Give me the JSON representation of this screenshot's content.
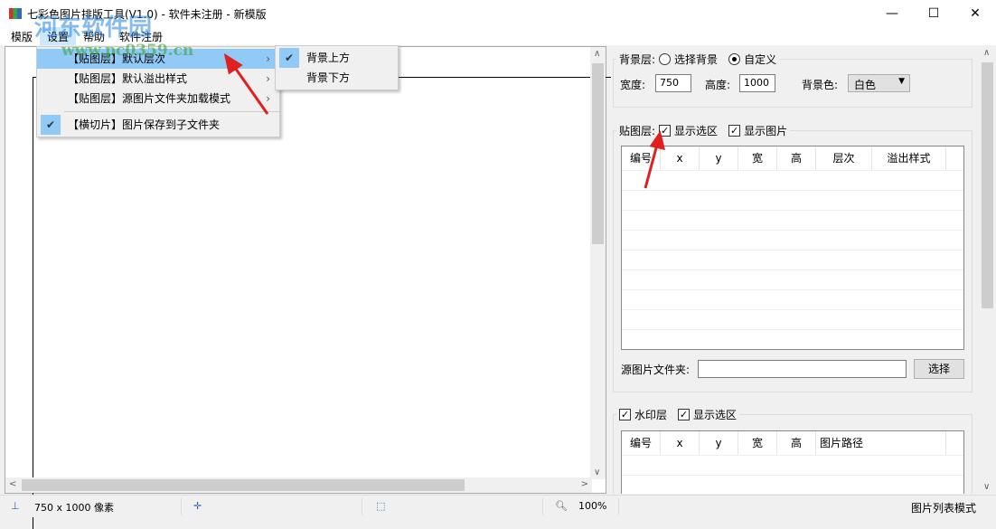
{
  "window": {
    "title": "七彩色图片排版工具(V1.0) - 软件未注册 - 新模版",
    "minimize": "—",
    "maximize": "☐",
    "close": "✕"
  },
  "menubar": [
    "模版",
    "设置",
    "帮助",
    "软件注册"
  ],
  "settings_menu": {
    "items": [
      {
        "label": "【贴图层】默认层次",
        "submenu": true,
        "checked": false
      },
      {
        "label": "【贴图层】默认溢出样式",
        "submenu": true,
        "checked": false
      },
      {
        "label": "【贴图层】源图片文件夹加载模式",
        "submenu": true,
        "checked": false
      },
      {
        "label": "【横切片】图片保存到子文件夹",
        "submenu": false,
        "checked": true
      }
    ],
    "submenu": [
      {
        "label": "背景上方",
        "checked": true
      },
      {
        "label": "背景下方",
        "checked": false
      }
    ]
  },
  "background": {
    "label": "背景层:",
    "option1": "选择背景",
    "option2": "自定义",
    "selected": "自定义",
    "width_label": "宽度:",
    "width": "750",
    "height_label": "高度:",
    "height": "1000",
    "color_label": "背景色:",
    "color": "白色"
  },
  "paste_layer": {
    "label": "贴图层:",
    "show_selection": "显示选区",
    "show_image": "显示图片",
    "columns": [
      "编号",
      "x",
      "y",
      "宽",
      "高",
      "层次",
      "溢出样式"
    ],
    "folder_label": "源图片文件夹:",
    "folder_value": "",
    "choose_button": "选择"
  },
  "watermark_layer": {
    "label": "水印层",
    "show_selection": "显示选区",
    "columns": [
      "编号",
      "x",
      "y",
      "宽",
      "高",
      "图片路径"
    ]
  },
  "status": {
    "size": "750 x 1000 像素",
    "zoom": "100%",
    "mode": "图片列表模式"
  },
  "overlay_watermark": {
    "line1": "河东软件园",
    "line2": "www.pc0359.cn"
  }
}
